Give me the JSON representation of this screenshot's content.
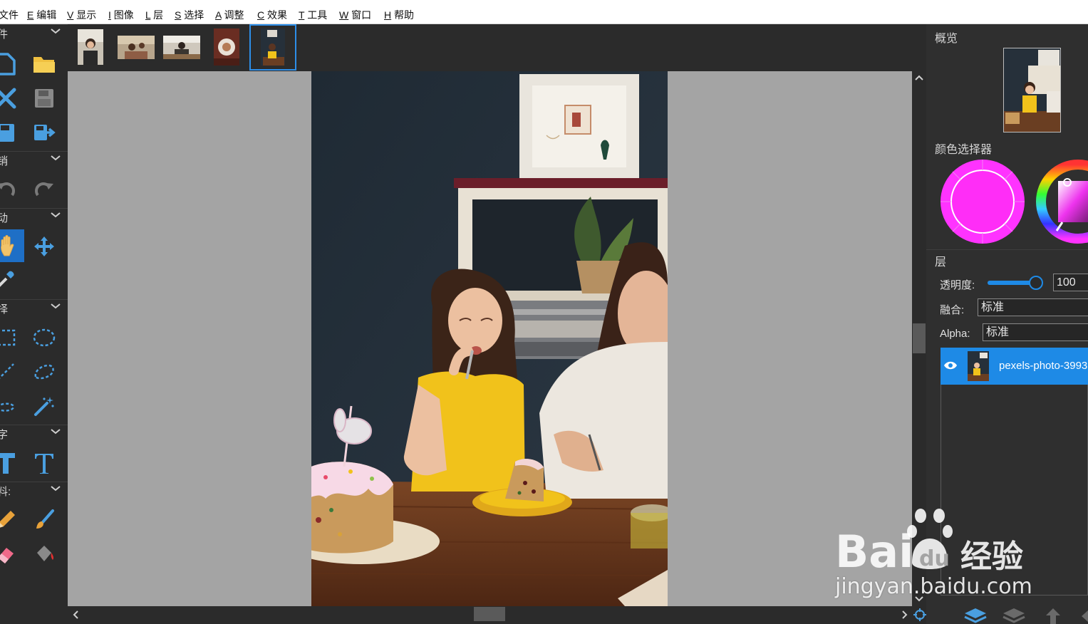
{
  "menu": [
    {
      "key": "",
      "label": "文件"
    },
    {
      "key": "E",
      "label": "编辑"
    },
    {
      "key": "V",
      "label": "显示"
    },
    {
      "key": "I",
      "label": "图像"
    },
    {
      "key": "L",
      "label": "层"
    },
    {
      "key": "S",
      "label": "选择"
    },
    {
      "key": "A",
      "label": "调整"
    },
    {
      "key": "C",
      "label": "效果"
    },
    {
      "key": "T",
      "label": "工具"
    },
    {
      "key": "W",
      "label": "窗口"
    },
    {
      "key": "H",
      "label": "帮助"
    }
  ],
  "toolbar": {
    "sections": [
      {
        "label": "件",
        "icons": [
          "new-file-icon",
          "open-folder-icon",
          "close-icon",
          "save-icon",
          "save-as-icon",
          "export-icon"
        ]
      },
      {
        "label": "销",
        "icons": [
          "undo-icon",
          "redo-icon"
        ]
      },
      {
        "label": "动",
        "icons": [
          "hand-icon",
          "move-icon",
          "eyedropper-icon"
        ]
      },
      {
        "label": "择",
        "icons": [
          "rect-select-icon",
          "ellipse-select-icon",
          "lasso-icon",
          "poly-lasso-icon",
          "free-select-icon",
          "magic-wand-icon"
        ]
      },
      {
        "label": "字",
        "icons": [
          "text-bold-icon",
          "text-icon"
        ]
      },
      {
        "label": "料:",
        "icons": [
          "pencil-icon",
          "brush-icon",
          "eraser-icon",
          "paint-bucket-icon"
        ]
      }
    ],
    "active_tool": "hand-icon"
  },
  "thumbnails": {
    "count": 5,
    "selected_index": 4
  },
  "panels": {
    "overview_title": "概览",
    "color_picker_title": "颜色选择器",
    "layers_title": "层",
    "opacity_label": "透明度:",
    "opacity_value": "100",
    "opacity_fraction": 0.95,
    "blend_label": "融合:",
    "blend_value": "标准",
    "alpha_label": "Alpha:",
    "alpha_value": "标准",
    "layer_name": "pexels-photo-3993",
    "primary_color": "#ff33ff"
  },
  "watermark": {
    "text": "jingyan.baidu.com",
    "logo": "Baidu经验"
  },
  "colors": {
    "accent": "#1e8ae6",
    "panel": "#2b2b2b",
    "canvas_bg": "#a4a4a4",
    "icon_blue": "#4a9fe0",
    "folder_yellow": "#f0c040"
  }
}
